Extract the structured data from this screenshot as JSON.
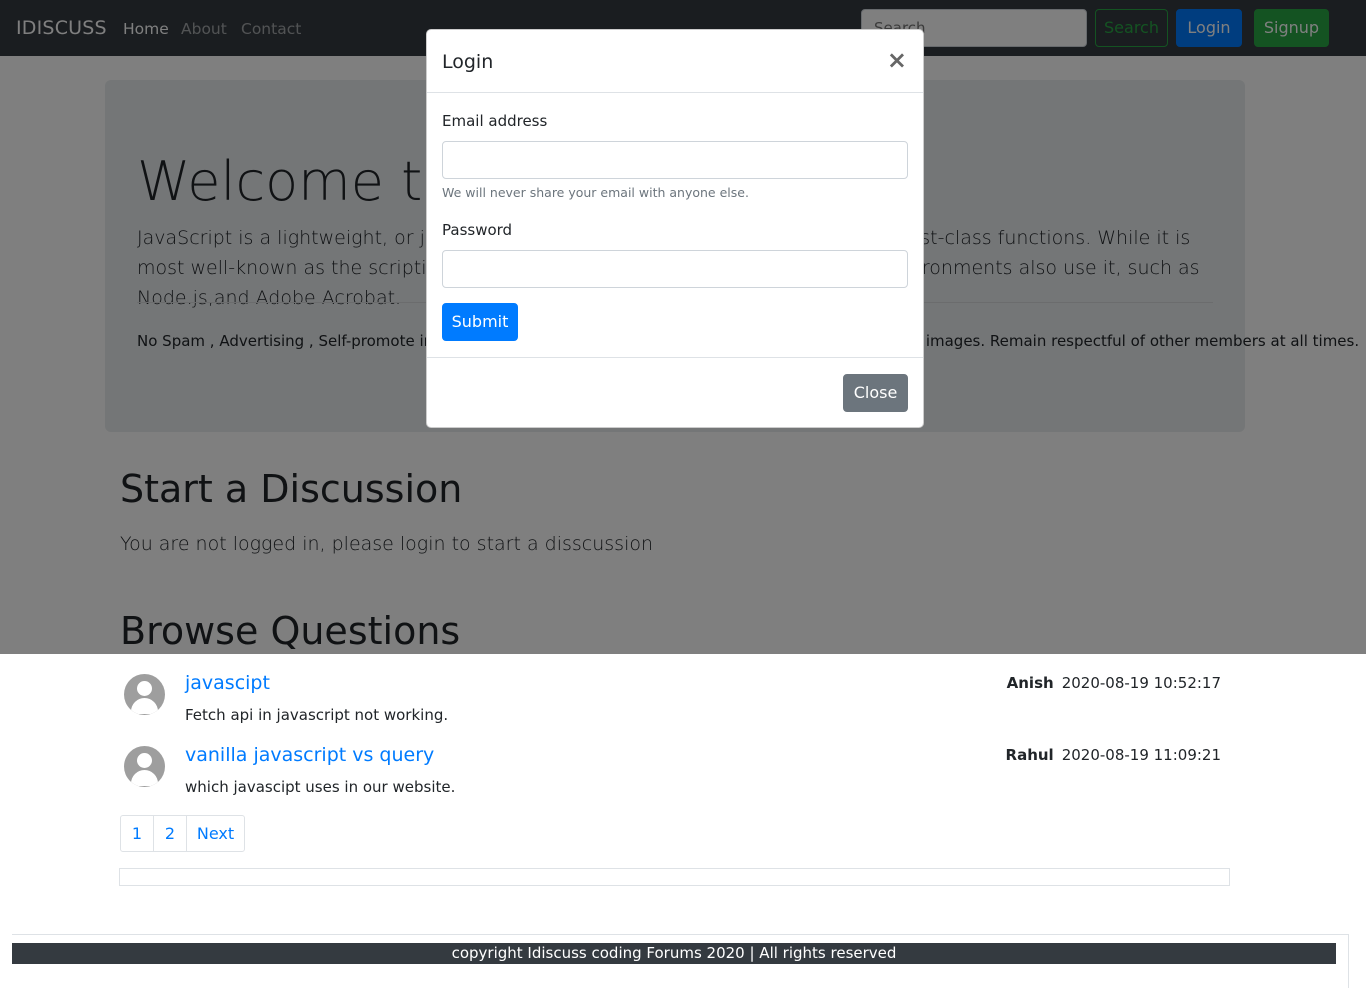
{
  "navbar": {
    "brand": "IDISCUSS",
    "links": [
      "Home",
      "About",
      "Contact"
    ],
    "search_placeholder": "Search",
    "search_button": "Search",
    "login_button": "Login",
    "signup_button": "Signup"
  },
  "jumbotron": {
    "title": "Welcome to",
    "lead": "JavaScript is a lightweight, or just-in-time compiled programming language with first-class functions. While it is most well-known as the scripting language for Web pages, many non-browser environments also use it, such as Node.js,and Adobe Acrobat.",
    "rules": "No Spam , Advertising , Self-promote in the forums is not allowed. Do not post \"offensive\" posts, links or images. Remain respectful of other members at all times."
  },
  "discussion": {
    "title": "Start a Discussion",
    "message": "You are not logged in, please login to start a disscussion"
  },
  "browse": {
    "title": "Browse Questions",
    "questions": [
      {
        "title": "javascipt",
        "description": "Fetch api in javascript not working.",
        "user": "Anish",
        "timestamp": "2020-08-19 10:52:17"
      },
      {
        "title": "vanilla javascript vs query",
        "description": "which javascipt uses in our website.",
        "user": "Rahul",
        "timestamp": "2020-08-19 11:09:21"
      }
    ],
    "pagination": [
      "1",
      "2",
      "Next"
    ]
  },
  "footer": {
    "text": "copyright Idiscuss coding Forums 2020 | All rights reserved"
  },
  "modal": {
    "title": "Login",
    "close_symbol": "×",
    "email_label": "Email address",
    "email_help": "We will never share your email with anyone else.",
    "password_label": "Password",
    "submit_button": "Submit",
    "close_button": "Close"
  },
  "colors": {
    "primary": "#007bff",
    "success": "#28a745",
    "secondary": "#6c757d",
    "dark": "#343a40"
  }
}
